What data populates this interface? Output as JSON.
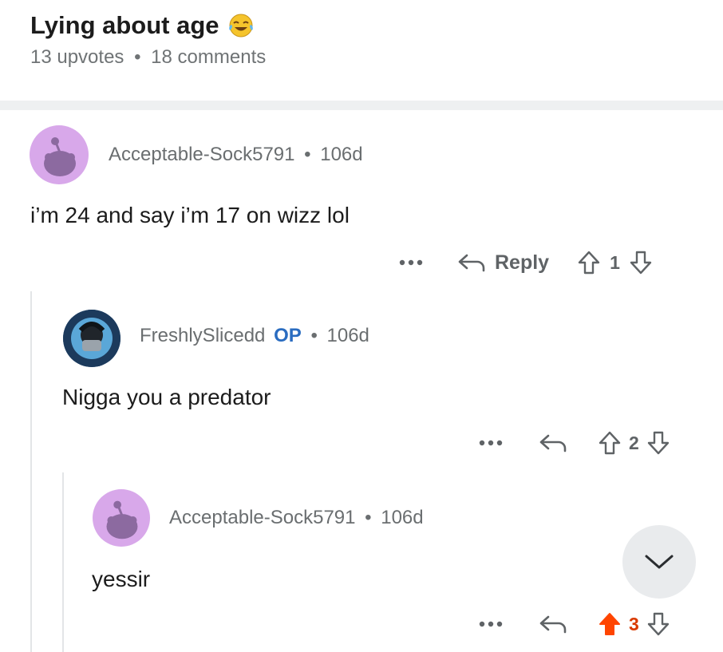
{
  "post": {
    "title": "Lying about age",
    "emoji_icon": "face-with-tears-of-joy-icon",
    "upvotes": "13 upvotes",
    "separator": "•",
    "comments": "18 comments"
  },
  "comments": [
    {
      "user": "Acceptable-Sock5791",
      "age": "106d",
      "text": "i’m 24 and say i’m 17 on wizz lol",
      "reply_label": "Reply",
      "score": "1",
      "avatar_color": "#d8a8ea"
    },
    {
      "user": "FreshlySlicedd",
      "op_badge": "OP",
      "age": "106d",
      "text": "Nigga you a predator",
      "score": "2",
      "avatar_color": "#3b6fa0"
    },
    {
      "user": "Acceptable-Sock5791",
      "age": "106d",
      "text": "yessir",
      "score": "3",
      "upvoted": true,
      "avatar_color": "#d8a8ea"
    }
  ],
  "colors": {
    "upvote_active": "#ff4500",
    "op": "#2a6cc0",
    "muted": "#6a6e70"
  },
  "more_icon": "ellipsis-icon",
  "scroll_button_icon": "chevron-down-icon"
}
